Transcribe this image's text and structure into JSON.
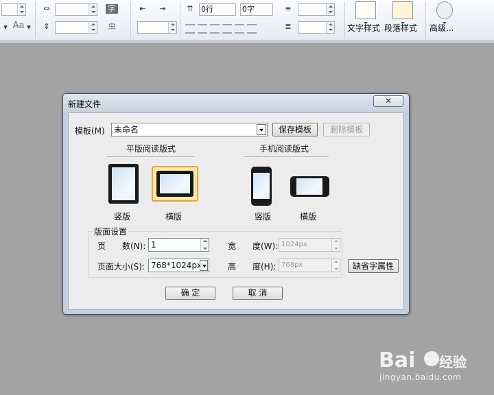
{
  "toolbar": {
    "char_icon": "字",
    "ruby_icon": "虫",
    "aa_label": "Aa",
    "spacing_before": "0行",
    "spacing_after": "0字",
    "text_style_label": "文字样式",
    "para_style_label": "段落样式",
    "advanced_label": "高级..."
  },
  "dialog": {
    "title": "新建文件",
    "close_glyph": "✕",
    "template_label": "模板(M)",
    "template_value": "未命名",
    "save_template": "保存模板",
    "delete_template": "删除模板",
    "tablet_section": "平版阅读版式",
    "phone_section": "手机阅读版式",
    "tablet_portrait": "竖版",
    "tablet_landscape": "横版",
    "phone_portrait": "竖版",
    "phone_landscape": "横版",
    "page_settings": "版面设置",
    "pages_label_a": "页",
    "pages_label_b": "数(N):",
    "pages_value": "1",
    "width_label_a": "宽",
    "width_label_b": "度(W):",
    "width_value": "1024px",
    "pagesize_label": "页面大小(S):",
    "pagesize_value": "768*1024px",
    "height_label_a": "高",
    "height_label_b": "度(H):",
    "height_value": "768px",
    "default_char_attr": "缺省字属性",
    "ok": "确  定",
    "cancel": "取  消"
  },
  "watermark": {
    "brand": "Bai",
    "brand_suffix": "经验",
    "url": "jingyan.baidu.com"
  }
}
